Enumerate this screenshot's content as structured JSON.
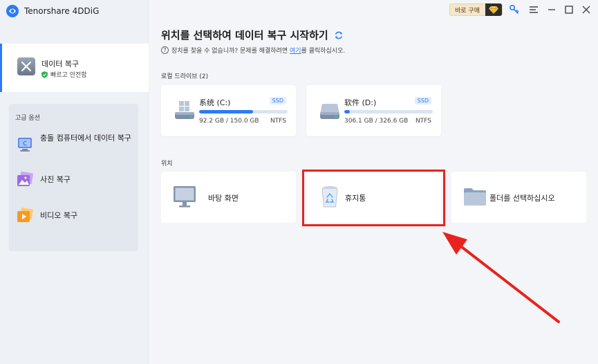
{
  "app": {
    "name": "Tenorshare 4DDiG"
  },
  "titlebar": {
    "buy_label": "바로 구매"
  },
  "sidebar": {
    "active_item": {
      "title": "데이터 복구",
      "subtitle": "빠르고 안전함"
    },
    "advanced": {
      "title": "고급 옵션",
      "items": [
        {
          "label": "충돌 컴퓨터에서 데이터 복구",
          "icon": "crashed-computer-icon"
        },
        {
          "label": "사진 복구",
          "icon": "photo-icon"
        },
        {
          "label": "비디오 복구",
          "icon": "video-icon"
        }
      ]
    }
  },
  "main": {
    "title": "위치를 선택하여 데이터 복구 시작하기",
    "help_prefix": "장치를 찾을 수 없습니까? 문제를 해결하려면 ",
    "help_link": "여기",
    "help_suffix": "를 클릭하십시오.",
    "local_drives_label": "로컬 드라이브 (2)",
    "drives": [
      {
        "name": "系统 (C:)",
        "type": "SSD",
        "size": "92.2 GB / 150.0 GB",
        "fs": "NTFS",
        "used_fraction": 0.61
      },
      {
        "name": "软件 (D:)",
        "type": "SSD",
        "size": "306.1 GB / 326.6 GB",
        "fs": "NTFS",
        "used_fraction": 0.06
      }
    ],
    "locations_label": "위치",
    "locations": [
      {
        "name": "바탕 화면",
        "icon": "desktop-monitor-icon"
      },
      {
        "name": "휴지통",
        "icon": "recycle-bin-icon"
      },
      {
        "name": "폴더를 선택하십시오",
        "icon": "folder-icon"
      }
    ]
  },
  "colors": {
    "accent": "#2b7bf6",
    "annotation": "#e8231e"
  }
}
